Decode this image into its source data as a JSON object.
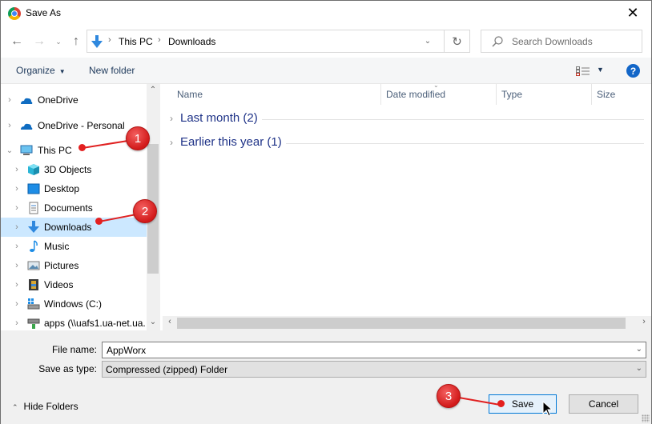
{
  "window": {
    "title": "Save As",
    "close_glyph": "✕"
  },
  "navbar": {
    "back_glyph": "←",
    "forward_glyph": "→",
    "recent_glyph": "⌄",
    "up_glyph": "↑",
    "breadcrumb": [
      "This PC",
      "Downloads"
    ],
    "separator_glyph": "›",
    "dropdown_glyph": "⌄",
    "refresh_glyph": "↻",
    "search_placeholder": "Search Downloads"
  },
  "commandbar": {
    "organize_label": "Organize",
    "caret_glyph": "▼",
    "new_folder_label": "New folder",
    "help_glyph": "?"
  },
  "navpane": {
    "items": [
      {
        "label": "OneDrive",
        "icon": "onedrive-icon",
        "expanded": false,
        "selected": false
      },
      {
        "label": "OneDrive - Personal",
        "icon": "onedrive-icon",
        "expanded": false,
        "selected": false
      },
      {
        "label": "This PC",
        "icon": "computer-icon",
        "expanded": true,
        "selected": false
      },
      {
        "label": "3D Objects",
        "icon": "3d-objects-icon",
        "expanded": false,
        "selected": false
      },
      {
        "label": "Desktop",
        "icon": "desktop-icon",
        "expanded": false,
        "selected": false
      },
      {
        "label": "Documents",
        "icon": "documents-icon",
        "expanded": false,
        "selected": false
      },
      {
        "label": "Downloads",
        "icon": "downloads-icon",
        "expanded": false,
        "selected": true
      },
      {
        "label": "Music",
        "icon": "music-icon",
        "expanded": false,
        "selected": false
      },
      {
        "label": "Pictures",
        "icon": "pictures-icon",
        "expanded": false,
        "selected": false
      },
      {
        "label": "Videos",
        "icon": "videos-icon",
        "expanded": false,
        "selected": false
      },
      {
        "label": "Windows (C:)",
        "icon": "drive-icon",
        "expanded": false,
        "selected": false
      },
      {
        "label": "apps (\\\\uafs1.ua-net.ua.",
        "icon": "network-drive-icon",
        "expanded": false,
        "selected": false
      }
    ],
    "collapsed_glyph": "›",
    "expanded_glyph": "⌄",
    "scroll_up_glyph": "⌃",
    "scroll_down_glyph": "⌄"
  },
  "filelist": {
    "columns": [
      "Name",
      "Date modified",
      "Type",
      "Size"
    ],
    "sorted_column": "Date modified",
    "sort_glyph": "⌄",
    "groups": [
      {
        "label": "Last month (2)"
      },
      {
        "label": "Earlier this year (1)"
      }
    ],
    "group_chevron_glyph": "›",
    "scroll_left_glyph": "‹",
    "scroll_right_glyph": "›"
  },
  "form": {
    "file_name_label": "File name:",
    "file_name_value": "AppWorx",
    "save_type_label": "Save as type:",
    "save_type_value": "Compressed (zipped) Folder",
    "dropdown_glyph": "⌄",
    "hide_folders_label": "Hide Folders",
    "hide_folders_glyph": "⌃",
    "save_label": "Save",
    "cancel_label": "Cancel"
  },
  "annotations": [
    {
      "number": "1",
      "target": "This PC"
    },
    {
      "number": "2",
      "target": "Downloads"
    },
    {
      "number": "3",
      "target": "Save"
    }
  ],
  "colors": {
    "accent": "#0078d7",
    "selection": "#cce8ff",
    "annotation": "#e02020",
    "group_text": "#1e3287",
    "help_icon": "#1266c8"
  }
}
